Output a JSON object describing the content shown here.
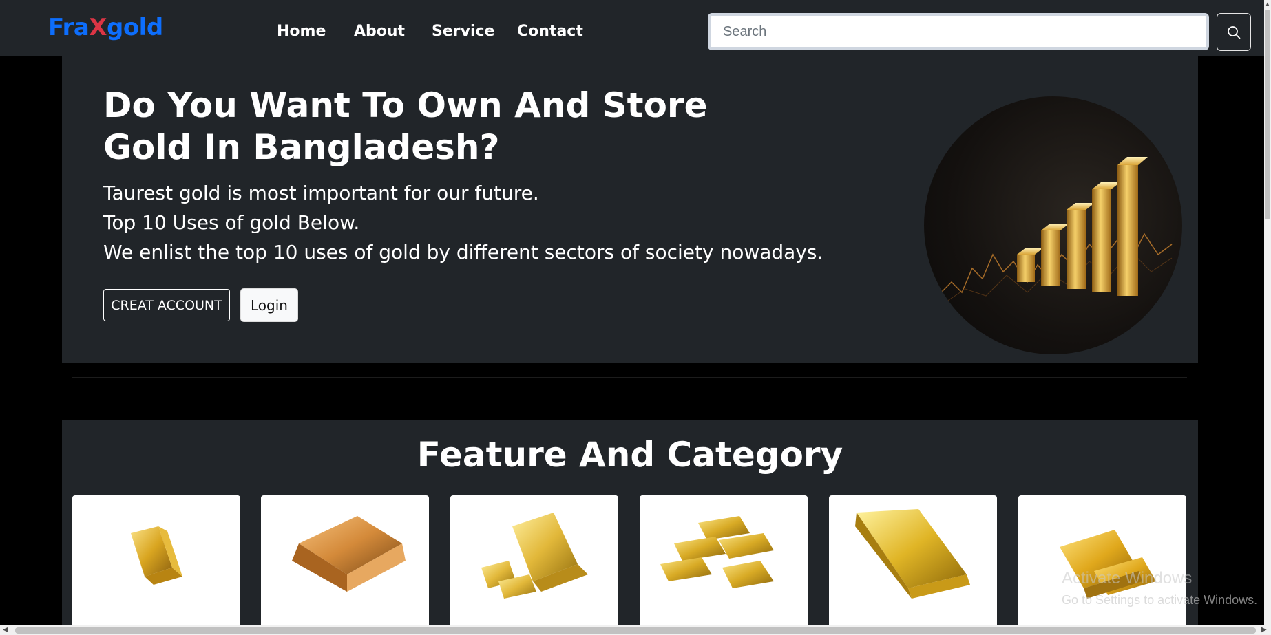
{
  "brand": {
    "part1": "Fra",
    "part2": "X",
    "part3": "gold"
  },
  "nav": [
    {
      "label": "Home"
    },
    {
      "label": "About"
    },
    {
      "label": "Service"
    },
    {
      "label": "Contact"
    }
  ],
  "search": {
    "placeholder": "Search",
    "icon": "search-icon"
  },
  "hero": {
    "title": "Do You Want To Own And Store Gold In Bangladesh?",
    "lines": [
      "Taurest gold is most important for our future.",
      "Top 10 Uses of gold Below.",
      "We enlist the top 10 uses of gold by different sectors of society nowadays."
    ],
    "create_account_label": "CREAT ACCOUNT",
    "login_label": "Login",
    "image": "gold-bar-chart-image"
  },
  "feature": {
    "title": "Feature And Category",
    "cards": [
      {
        "image": "gold-bar-image"
      },
      {
        "image": "gold-bar-image"
      },
      {
        "image": "gold-bars-stack-image"
      },
      {
        "image": "gold-bars-stack-image"
      },
      {
        "image": "gold-bar-image"
      },
      {
        "image": "gold-bars-stack-image"
      }
    ]
  },
  "watermark": {
    "line1": "Activate Windows",
    "line2": "Go to Settings to activate Windows."
  },
  "colors": {
    "brand_blue": "#0d6efd",
    "brand_red": "#dc3545",
    "panel": "#212529",
    "gold": "#d4a017"
  }
}
